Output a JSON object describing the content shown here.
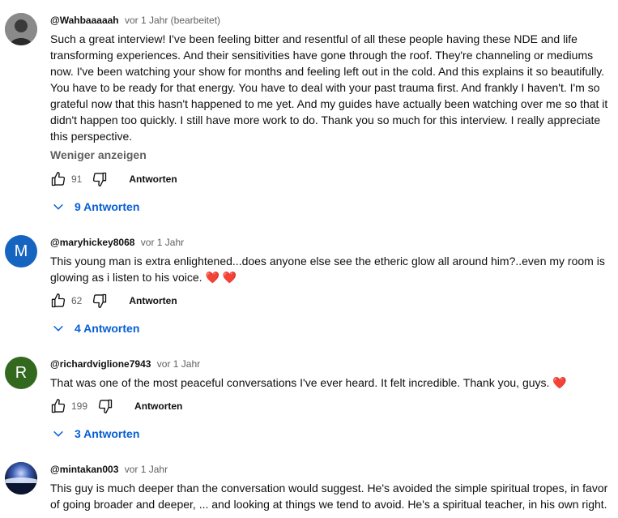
{
  "comments": [
    {
      "author": "@Wahbaaaaah",
      "time": "vor 1 Jahr (bearbeitet)",
      "text": "Such a great interview!  I've been feeling bitter and resentful of all these people having these NDE and life transforming experiences. And their sensitivities have gone through the roof.  They're channeling or mediums now.  I've been watching your show for months and feeling left out in the cold.  And this explains it so beautifully.  You have to be ready for that energy.  You have to deal with your past trauma first.  And frankly I haven't.  I'm so grateful now that this hasn't happened to me yet.  And my guides have actually been watching over me so that it didn't happen too quickly.  I still have more work to do.   Thank you so much for this interview.  I really appreciate this perspective.",
      "show_less": "Weniger anzeigen",
      "likes": "91",
      "reply_label": "Antworten",
      "replies_label": "9 Antworten"
    },
    {
      "author": "@maryhickey8068",
      "time": "vor 1 Jahr",
      "avatar_letter": "M",
      "avatar_color": "#1565c0",
      "text": "This young man is extra enlightened...does anyone else see the etheric glow all around him?..even my room is glowing as i listen to his voice.",
      "emoji": "❤️ ❤️",
      "likes": "62",
      "reply_label": "Antworten",
      "replies_label": "4 Antworten"
    },
    {
      "author": "@richardviglione7943",
      "time": "vor 1 Jahr",
      "avatar_letter": "R",
      "avatar_color": "#33691e",
      "text": "That was one of the most peaceful conversations I've ever heard. It felt incredible. Thank you, guys.",
      "emoji": "❤️",
      "likes": "199",
      "reply_label": "Antworten",
      "replies_label": "3 Antworten"
    },
    {
      "author": "@mintakan003",
      "time": "vor 1 Jahr",
      "text": "This guy is much deeper than the conversation would suggest.  He's avoided the simple spiritual tropes, in favor of going broader and deeper, ... and looking at things we tend to avoid.  He's a spiritual teacher, in his own right."
    }
  ]
}
